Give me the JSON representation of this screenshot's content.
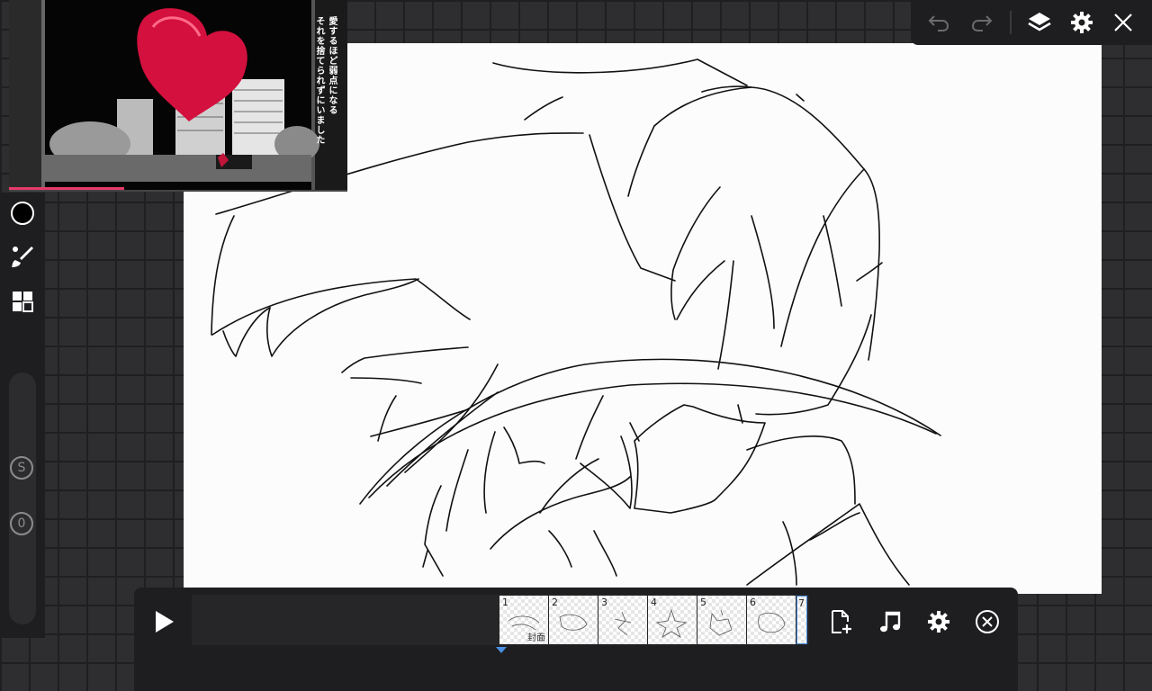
{
  "reference": {
    "caption_line1": "愛するほど弱点になる",
    "caption_line2": "それを捨てられずにいました"
  },
  "tools": {
    "color_icon": "color-swatch-icon",
    "brush_icon": "brush-icon",
    "material_icon": "grid-icon",
    "size_knob_label": "S",
    "opacity_knob_label": "0"
  },
  "topbar": {
    "undo_icon": "undo-icon",
    "redo_icon": "redo-icon",
    "layers_icon": "layers-icon",
    "settings_icon": "gear-icon",
    "close_icon": "close-icon"
  },
  "timeline": {
    "frames": [
      {
        "number": "1",
        "label": "封面"
      },
      {
        "number": "2",
        "label": ""
      },
      {
        "number": "3",
        "label": ""
      },
      {
        "number": "4",
        "label": ""
      },
      {
        "number": "5",
        "label": ""
      },
      {
        "number": "6",
        "label": ""
      },
      {
        "number": "7",
        "label": ""
      }
    ],
    "play_icon": "play-icon",
    "add_frame_icon": "add-frame-icon",
    "music_icon": "music-icon",
    "settings_icon": "gear-icon",
    "close_icon": "close-circle-icon"
  },
  "colors": {
    "accent": "#4a90e2",
    "progress": "#e83a6a",
    "brush_color": "#000000"
  }
}
